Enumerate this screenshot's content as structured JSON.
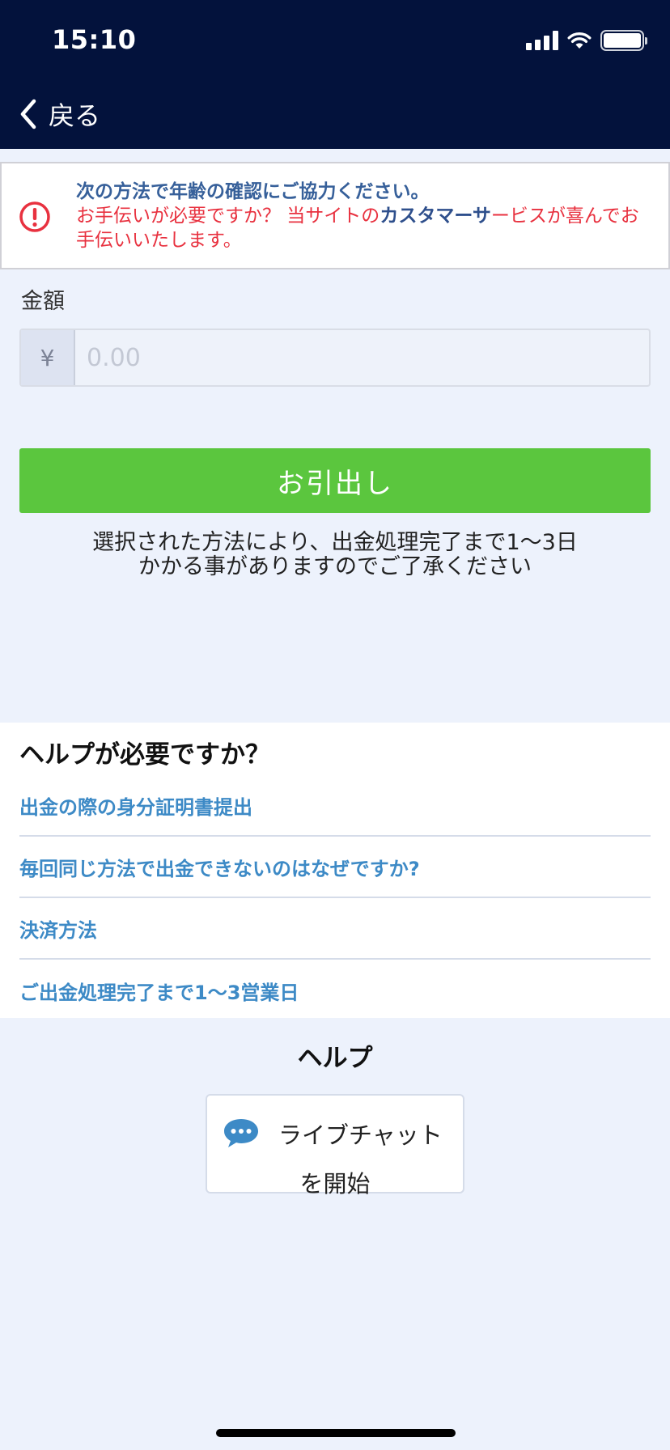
{
  "status_bar": {
    "time": "15:10"
  },
  "nav": {
    "back_label": "戻る"
  },
  "alert": {
    "line1": "次の方法で年齢の確認にご協力ください。",
    "line2_prefix": "お手伝いが必要ですか？ 当サイトの",
    "link": "カスタマーサ",
    "line2_suffix": "ービスが喜んでお手伝いいたします。"
  },
  "amount": {
    "label": "金額",
    "currency_symbol": "¥",
    "placeholder": "0.00"
  },
  "withdraw_button": "お引出し",
  "notice": {
    "line1": "選択された方法により、出金処理完了まで1〜3日",
    "line2": "かかる事がありますのでご了承ください"
  },
  "help": {
    "title": "ヘルプが必要ですか？",
    "items": [
      "出金の際の身分証明書提出",
      "毎回同じ方法で出金できないのはなぜですか?",
      "決済方法",
      "ご出金処理完了まで1〜3営業日"
    ]
  },
  "support": {
    "heading": "ヘルプ",
    "chat_line1": "ライブチャット",
    "chat_line2": "を開始"
  }
}
